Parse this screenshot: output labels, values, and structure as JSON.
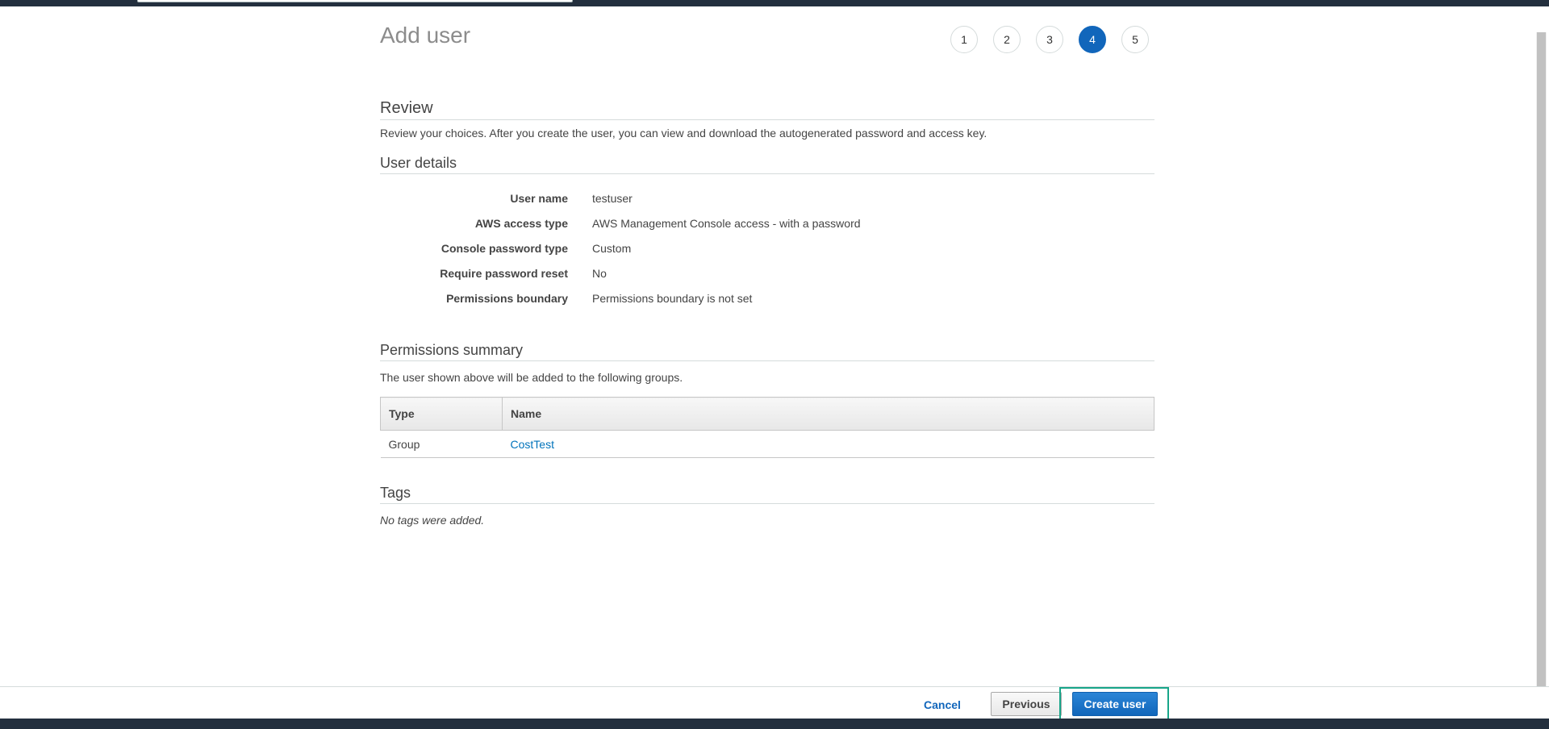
{
  "page": {
    "title": "Add user"
  },
  "steps": [
    {
      "label": "1",
      "active": false
    },
    {
      "label": "2",
      "active": false
    },
    {
      "label": "3",
      "active": false
    },
    {
      "label": "4",
      "active": true
    },
    {
      "label": "5",
      "active": false
    }
  ],
  "review": {
    "heading": "Review",
    "description": "Review your choices. After you create the user, you can view and download the autogenerated password and access key."
  },
  "user_details": {
    "heading": "User details",
    "rows": [
      {
        "key": "User name",
        "value": "testuser"
      },
      {
        "key": "AWS access type",
        "value": "AWS Management Console access - with a password"
      },
      {
        "key": "Console password type",
        "value": "Custom"
      },
      {
        "key": "Require password reset",
        "value": "No"
      },
      {
        "key": "Permissions boundary",
        "value": "Permissions boundary is not set"
      }
    ]
  },
  "permissions": {
    "heading": "Permissions summary",
    "description": "The user shown above will be added to the following groups.",
    "columns": [
      "Type",
      "Name"
    ],
    "rows": [
      {
        "type": "Group",
        "name": "CostTest"
      }
    ]
  },
  "tags": {
    "heading": "Tags",
    "empty_text": "No tags were added."
  },
  "footer": {
    "cancel_label": "Cancel",
    "previous_label": "Previous",
    "create_label": "Create user"
  },
  "colors": {
    "accent": "#1166bb",
    "topbar": "#232f3e",
    "highlight": "#17a589",
    "link": "#0073bb"
  }
}
